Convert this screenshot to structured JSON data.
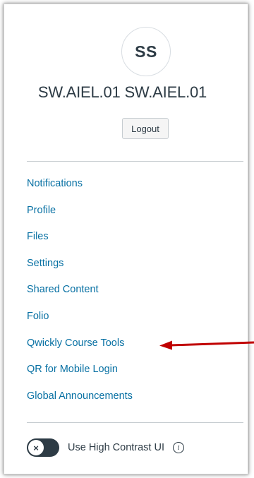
{
  "profile": {
    "initials": "SS",
    "display_name": "SW.AIEL.01 SW.AIEL.01",
    "logout_label": "Logout"
  },
  "nav": {
    "items": [
      {
        "label": "Notifications"
      },
      {
        "label": "Profile"
      },
      {
        "label": "Files"
      },
      {
        "label": "Settings"
      },
      {
        "label": "Shared Content"
      },
      {
        "label": "Folio"
      },
      {
        "label": "Qwickly Course Tools"
      },
      {
        "label": "QR for Mobile Login"
      },
      {
        "label": "Global Announcements"
      }
    ]
  },
  "contrast": {
    "label": "Use High Contrast UI",
    "toggle_state": "off",
    "toggle_symbol": "×",
    "info_symbol": "i"
  },
  "colors": {
    "link": "#0770a3",
    "text": "#2d3b45",
    "arrow": "#c00000"
  }
}
